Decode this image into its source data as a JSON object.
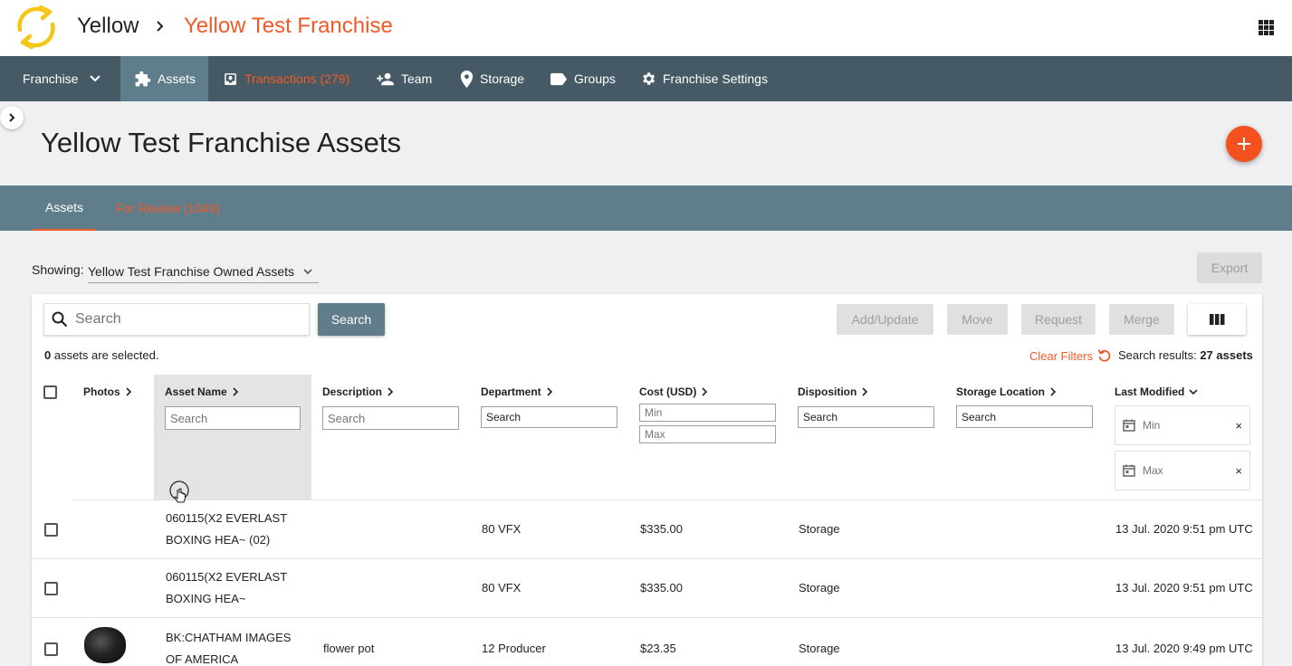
{
  "breadcrumb": {
    "root": "Yellow",
    "current": "Yellow Test Franchise"
  },
  "nav": {
    "franchise": "Franchise",
    "assets": "Assets",
    "transactions": "Transactions (279)",
    "team": "Team",
    "storage": "Storage",
    "groups": "Groups",
    "settings": "Franchise Settings"
  },
  "page": {
    "title": "Yellow Test Franchise Assets"
  },
  "subtabs": {
    "assets": "Assets",
    "review": "For Review (1049)"
  },
  "showing": {
    "label": "Showing:",
    "value": "Yellow Test Franchise Owned Assets"
  },
  "toolbar": {
    "export": "Export",
    "search_placeholder": "Search",
    "search_button": "Search",
    "add_update": "Add/Update",
    "move": "Move",
    "request": "Request",
    "merge": "Merge"
  },
  "status": {
    "selected_count": "0",
    "selected_suffix": " assets are selected.",
    "clear_filters": "Clear Filters",
    "results_label": "Search results: ",
    "results_value": "27 assets"
  },
  "columns": {
    "photos": "Photos",
    "asset_name": "Asset Name",
    "description": "Description",
    "department": "Department",
    "cost": "Cost (USD)",
    "disposition": "Disposition",
    "storage_location": "Storage Location",
    "last_modified": "Last Modified"
  },
  "filters": {
    "asset_name": "Search",
    "description": "Search",
    "department": "Search",
    "cost_min": "Min",
    "cost_max": "Max",
    "disposition": "Search",
    "storage_location": "Search",
    "date_min": "Min",
    "date_max": "Max",
    "clear_symbol": "×"
  },
  "rows": [
    {
      "name_line1": "060115(X2 EVERLAST",
      "name_line2": "BOXING HEA~ (02)",
      "description": "",
      "department": "80 VFX",
      "cost": "$335.00",
      "disposition": "Storage",
      "modified": "13 Jul. 2020 9:51 pm UTC",
      "has_photo": false
    },
    {
      "name_line1": "060115(X2 EVERLAST",
      "name_line2": "BOXING HEA~",
      "description": "",
      "department": "80 VFX",
      "cost": "$335.00",
      "disposition": "Storage",
      "modified": "13 Jul. 2020 9:51 pm UTC",
      "has_photo": false
    },
    {
      "name_line1": "BK:CHATHAM IMAGES",
      "name_line2": "OF AMERICA",
      "description": "flower pot",
      "department": "12 Producer",
      "cost": "$23.35",
      "disposition": "Storage",
      "modified": "13 Jul. 2020 9:49 pm UTC",
      "has_photo": true
    }
  ],
  "colors": {
    "accent": "#f05a28",
    "nav_bg": "#455a64",
    "subnav_bg": "#607d8b",
    "logo": "#f5c518"
  }
}
